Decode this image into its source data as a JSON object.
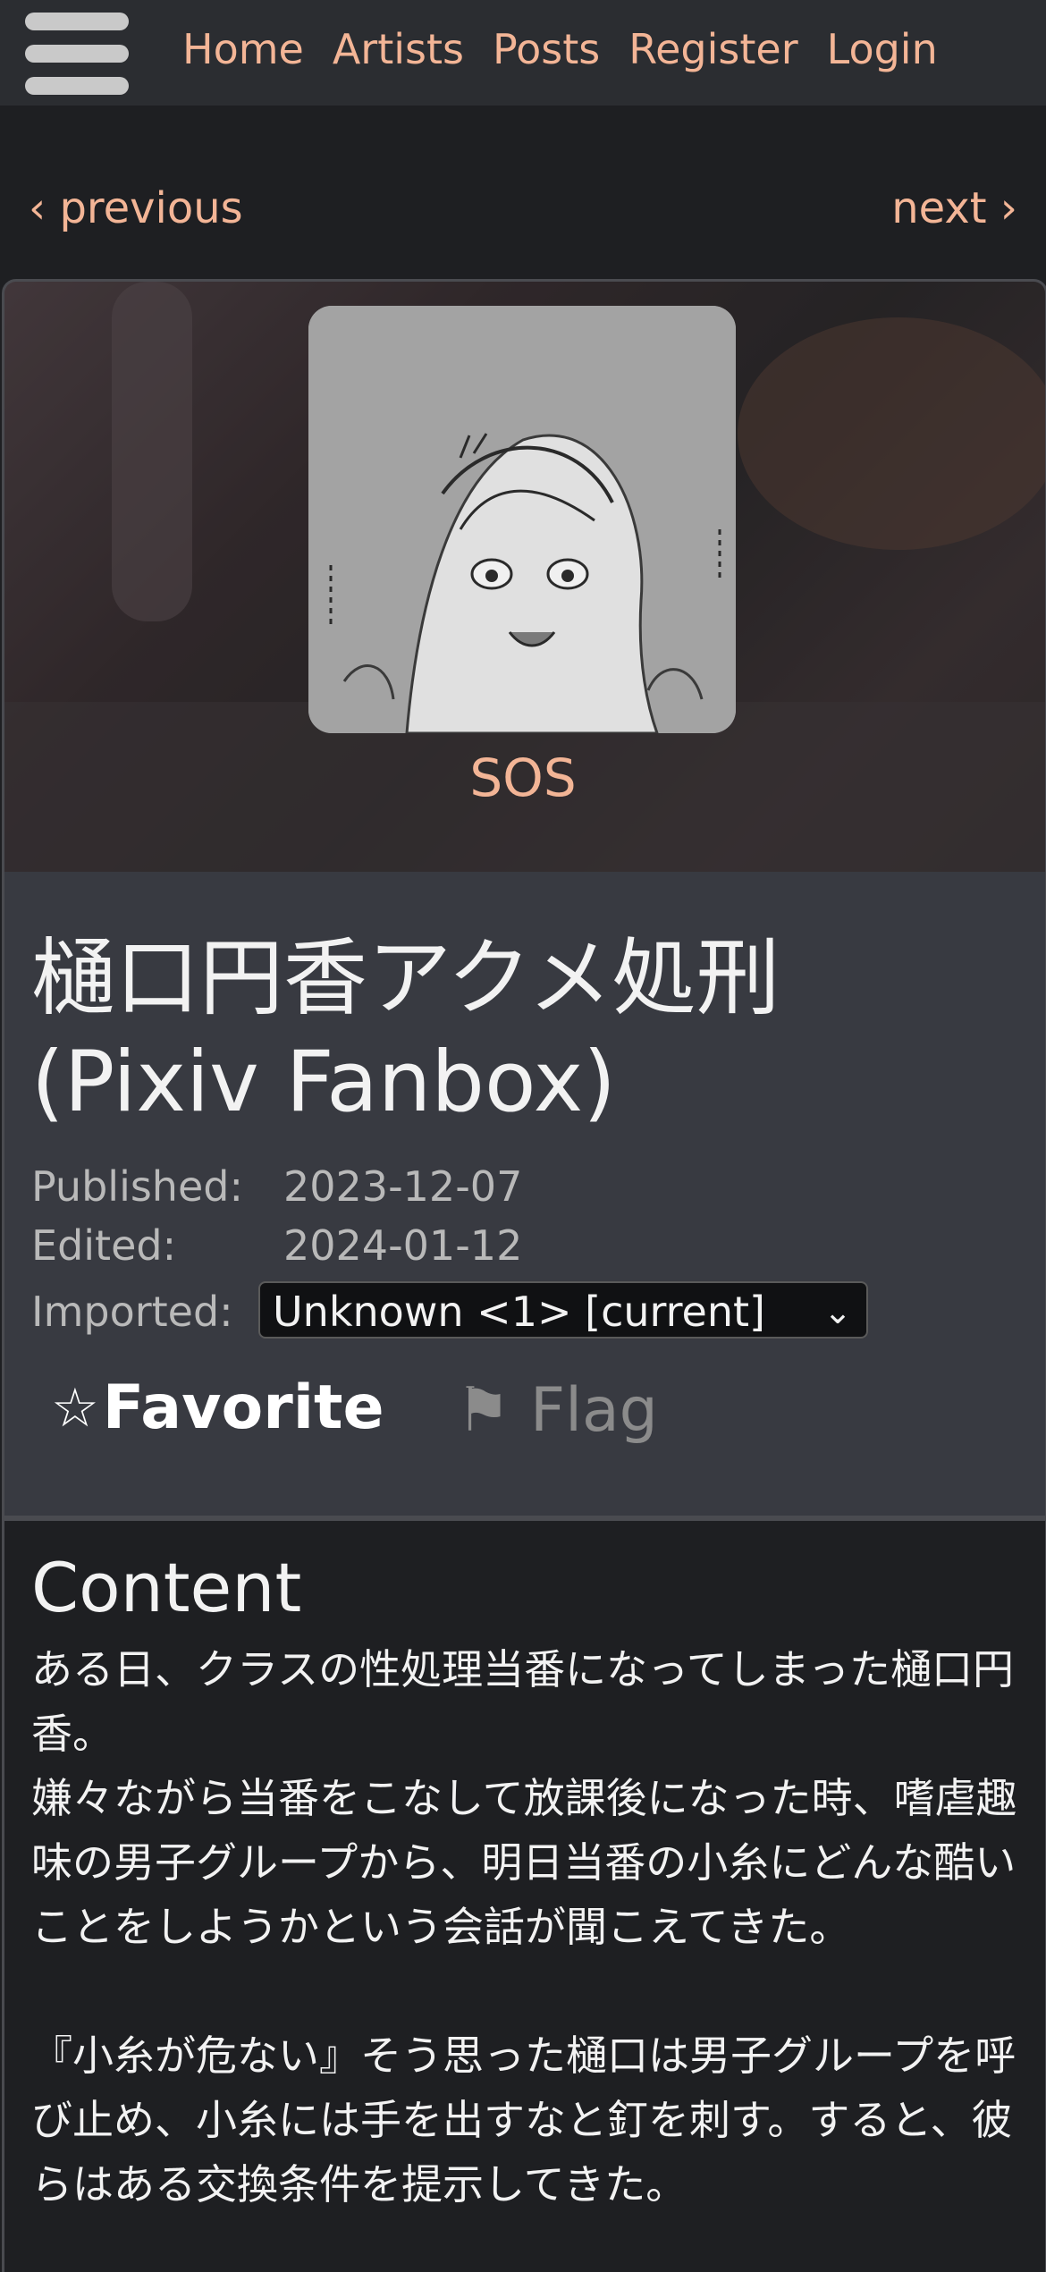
{
  "nav": {
    "links": [
      "Home",
      "Artists",
      "Posts",
      "Register",
      "Login"
    ]
  },
  "pager": {
    "previous": "‹ previous",
    "next": "next ›"
  },
  "artist": {
    "name": "SOS"
  },
  "post": {
    "title": "樋口円香アクメ処刑 (Pixiv Fanbox)",
    "published_label": "Published:",
    "published_value": "2023-12-07",
    "edited_label": "Edited:",
    "edited_value": "2024-01-12",
    "imported_label": "Imported:",
    "imported_selected": "Unknown <1> [current]",
    "favorite_label": "Favorite",
    "flag_label": "Flag"
  },
  "content": {
    "heading": "Content",
    "paragraph1_line1": "ある日、クラスの性処理当番になってしまった樋口円香。",
    "paragraph1_line2": "嫌々ながら当番をこなして放課後になった時、嗜虐趣味の男子グループから、明日当番の小糸にどんな酷いことをしようかという会話が聞こえてきた。",
    "paragraph2": "『小糸が危ない』そう思った樋口は男子グループを呼び止め、小糸には手を出すなと釘を刺す。すると、彼らはある交換条件を提示してきた。"
  },
  "colors": {
    "accent": "#f3b596",
    "navbar": "#2b2d31",
    "background": "#1e1f22",
    "meta_panel": "#383a41"
  },
  "icons": {
    "menu": "hamburger-icon",
    "favorite": "star-outline-icon",
    "flag": "flag-icon",
    "select": "chevron-down-icon"
  }
}
